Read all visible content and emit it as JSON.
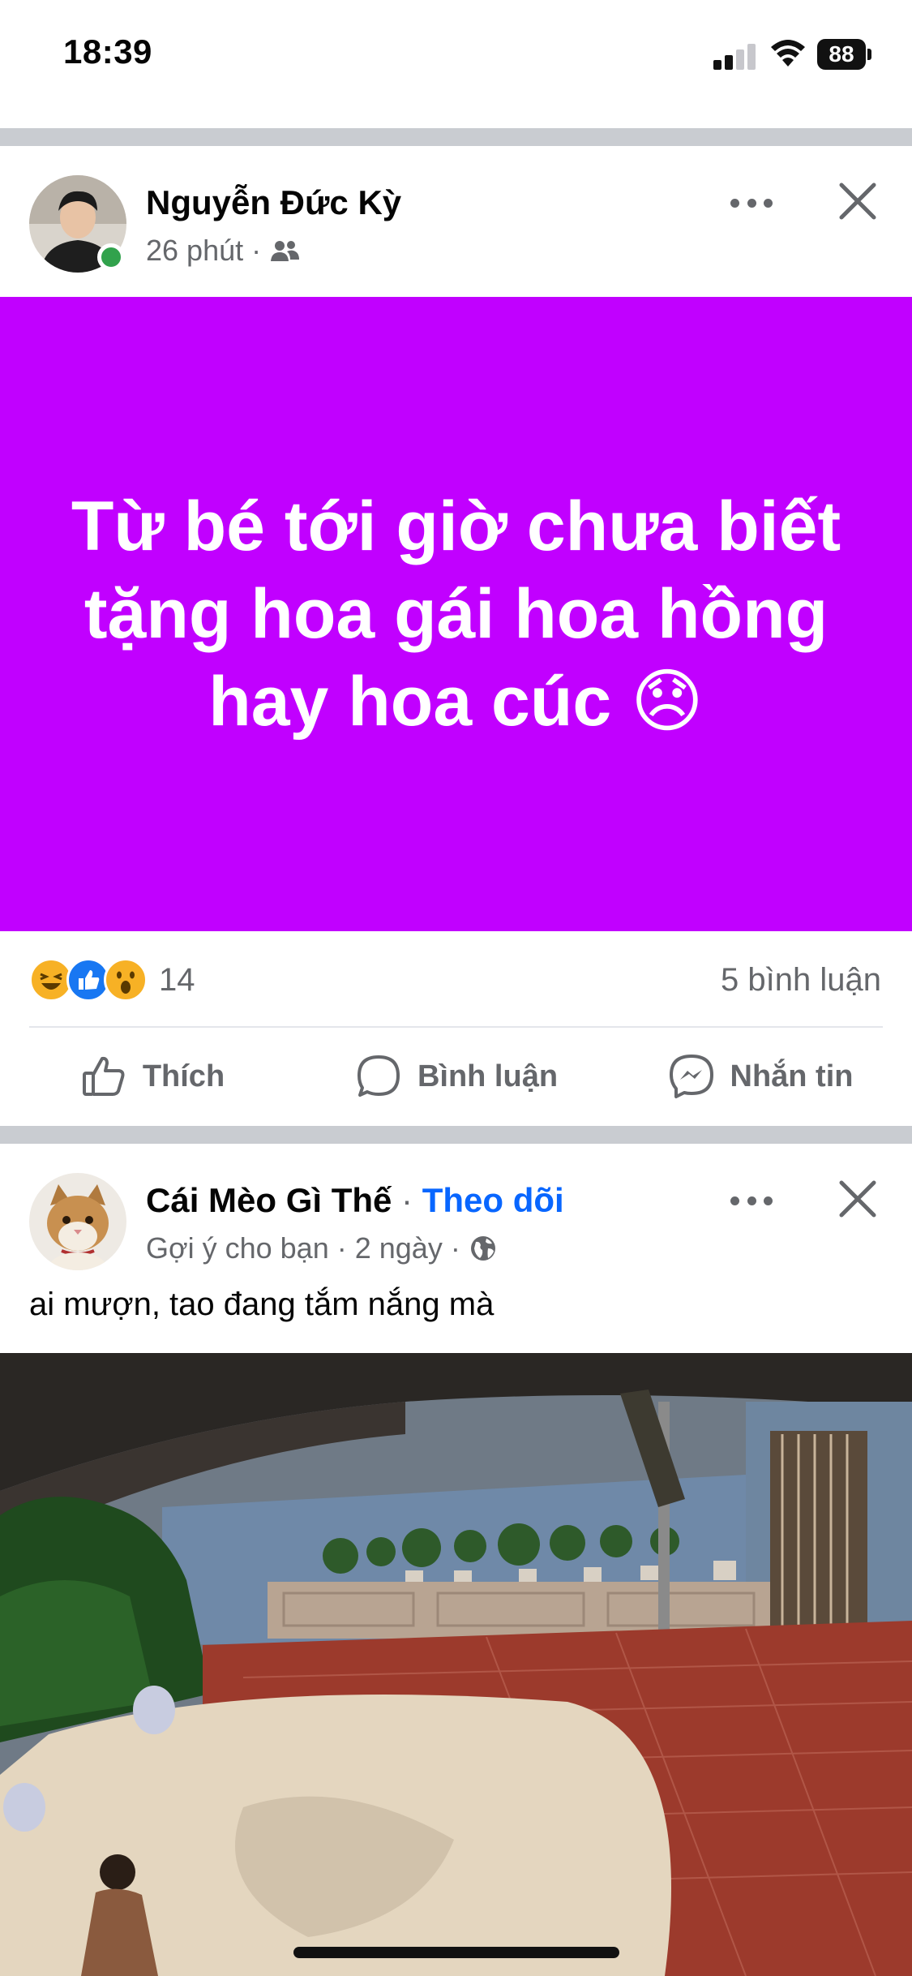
{
  "status_bar": {
    "time": "18:39",
    "battery": "88"
  },
  "post1": {
    "author": "Nguyễn Đức Kỳ",
    "time": "26 phút",
    "privacy_icon": "friends-icon",
    "text": "Từ bé tới giờ chưa biết tặng hoa gái hoa hồng hay hoa cúc 😞",
    "background_color": "#c100ff",
    "reactions": [
      "haha",
      "like",
      "wow"
    ],
    "reaction_count": "14",
    "comments": "5 bình luận"
  },
  "actions": {
    "like": "Thích",
    "comment": "Bình luận",
    "message": "Nhắn tin"
  },
  "post2": {
    "author": "Cái Mèo Gì Thế",
    "separator": " · ",
    "follow": "Theo dõi",
    "suggested": "Gợi ý cho bạn",
    "time": "2 ngày",
    "privacy_icon": "globe-icon",
    "caption": "ai mượn, tao đang tắm nắng mà"
  }
}
